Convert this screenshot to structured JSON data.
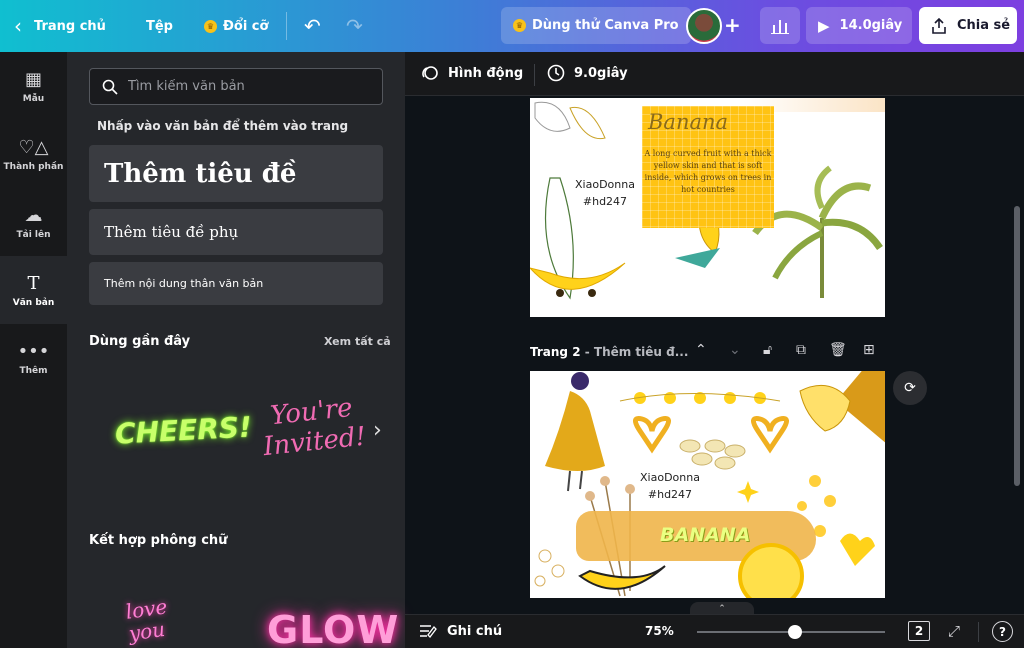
{
  "topbar": {
    "home": "Trang chủ",
    "file": "Tệp",
    "resize": "Đổi cỡ",
    "try_pro": "Dùng thử Canva Pro",
    "present_time": "14.0giây",
    "share": "Chia sẻ"
  },
  "rail": {
    "items": [
      {
        "label": "Mẫu",
        "icon": "layout-icon"
      },
      {
        "label": "Thành phần",
        "icon": "shapes-icon"
      },
      {
        "label": "Tải lên",
        "icon": "upload-icon"
      },
      {
        "label": "Văn bản",
        "icon": "text-icon"
      },
      {
        "label": "Thêm",
        "icon": "more-icon"
      }
    ]
  },
  "panel": {
    "search_placeholder": "Tìm kiếm văn bản",
    "hint": "Nhấp vào văn bản để thêm vào trang",
    "add_heading": "Thêm tiêu đề",
    "add_subheading": "Thêm tiêu đề phụ",
    "add_body": "Thêm nội dung thân văn bản",
    "recent_title": "Dùng gần đây",
    "see_all": "Xem tất cả",
    "recent_items": [
      "CHEERS!",
      "You're Invited!"
    ],
    "combo_title": "Kết hợp phông chữ",
    "combo_items": [
      "love you",
      "GLOW"
    ]
  },
  "editor": {
    "animate": "Hình động",
    "duration": "9.0giây",
    "page2_label": "Trang 2",
    "page2_title": " - Thêm tiêu đ...",
    "page1": {
      "title": "Banana",
      "description": "A long curved fruit with a thick yellow skin and that is soft inside, which grows on trees in hot countries",
      "author": "XiaoDonna",
      "tag": "#hd247"
    },
    "page2": {
      "author": "XiaoDonna",
      "tag": "#hd247",
      "banner": "BANANA"
    }
  },
  "bottombar": {
    "notes": "Ghi chú",
    "zoom": "75%",
    "zoom_value": 75,
    "page_count": "2"
  },
  "colors": {
    "accent_gradient_start": "#10bfd0",
    "accent_gradient_end": "#7d3fe0",
    "panel_bg": "#25272b",
    "canvas_bg": "#0e1318",
    "banana_yellow": "#ffc313"
  }
}
